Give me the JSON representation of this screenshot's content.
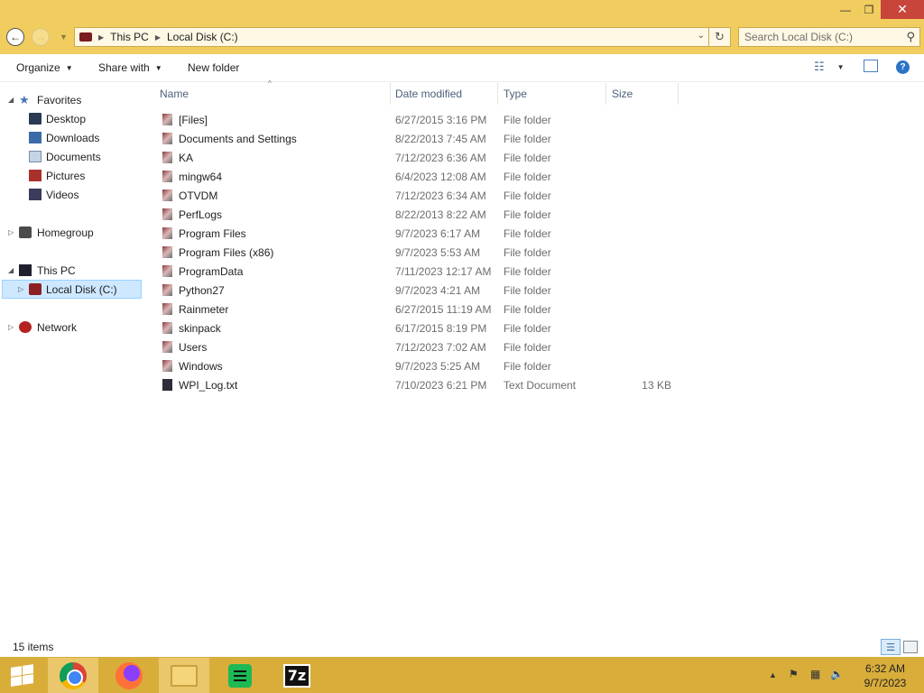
{
  "window": {
    "minimize_glyph": "—",
    "maximize_glyph": "❐",
    "close_glyph": "✕"
  },
  "address": {
    "back_glyph": "←",
    "forward_glyph": "→",
    "recent_glyph": "▼",
    "crumbs": [
      "This PC",
      "Local Disk (C:)"
    ],
    "separator_glyph": "▶",
    "dropdown_glyph": "⌄",
    "refresh_glyph": "↻",
    "search_placeholder": "Search Local Disk (C:)",
    "search_icon_glyph": "⚲"
  },
  "toolbar": {
    "organize": "Organize",
    "share_with": "Share with",
    "new_folder": "New folder",
    "caret_glyph": "▼",
    "views_glyph": "☷",
    "help_glyph": "?"
  },
  "nav": {
    "favorites": {
      "label": "Favorites",
      "items": [
        "Desktop",
        "Downloads",
        "Documents",
        "Pictures",
        "Videos"
      ]
    },
    "homegroup": "Homegroup",
    "this_pc": "This PC",
    "local_disk": "Local Disk (C:)",
    "network": "Network",
    "expanded_glyph": "◢",
    "collapsed_glyph": "▷",
    "star_glyph": "★"
  },
  "columns": {
    "name": "Name",
    "date": "Date modified",
    "type": "Type",
    "size": "Size",
    "sort_glyph": "^"
  },
  "files": [
    {
      "name": "[Files]",
      "date": "6/27/2015 3:16 PM",
      "type": "File folder",
      "size": ""
    },
    {
      "name": "Documents and Settings",
      "date": "8/22/2013 7:45 AM",
      "type": "File folder",
      "size": ""
    },
    {
      "name": "KA",
      "date": "7/12/2023 6:36 AM",
      "type": "File folder",
      "size": ""
    },
    {
      "name": "mingw64",
      "date": "6/4/2023 12:08 AM",
      "type": "File folder",
      "size": ""
    },
    {
      "name": "OTVDM",
      "date": "7/12/2023 6:34 AM",
      "type": "File folder",
      "size": ""
    },
    {
      "name": "PerfLogs",
      "date": "8/22/2013 8:22 AM",
      "type": "File folder",
      "size": ""
    },
    {
      "name": "Program Files",
      "date": "9/7/2023 6:17 AM",
      "type": "File folder",
      "size": ""
    },
    {
      "name": "Program Files (x86)",
      "date": "9/7/2023 5:53 AM",
      "type": "File folder",
      "size": ""
    },
    {
      "name": "ProgramData",
      "date": "7/11/2023 12:17 AM",
      "type": "File folder",
      "size": ""
    },
    {
      "name": "Python27",
      "date": "9/7/2023 4:21 AM",
      "type": "File folder",
      "size": ""
    },
    {
      "name": "Rainmeter",
      "date": "6/27/2015 11:19 AM",
      "type": "File folder",
      "size": ""
    },
    {
      "name": "skinpack",
      "date": "6/17/2015 8:19 PM",
      "type": "File folder",
      "size": ""
    },
    {
      "name": "Users",
      "date": "7/12/2023 7:02 AM",
      "type": "File folder",
      "size": ""
    },
    {
      "name": "Windows",
      "date": "9/7/2023 5:25 AM",
      "type": "File folder",
      "size": ""
    },
    {
      "name": "WPI_Log.txt",
      "date": "7/10/2023 6:21 PM",
      "type": "Text Document",
      "size": "13 KB"
    }
  ],
  "status": {
    "item_count": "15 items",
    "details_glyph": "☰"
  },
  "taskbar": {
    "apps": [
      "chrome-icon",
      "firefox-icon",
      "file-explorer-icon",
      "spreadsheet-icon",
      "7zip-icon"
    ],
    "zip_label": "7z",
    "tray_up_glyph": "▲",
    "tray_flag_glyph": "⚑",
    "tray_network_glyph": "▦",
    "tray_volume_glyph": "🔈",
    "time": "6:32 AM",
    "date": "9/7/2023"
  },
  "colors": {
    "accent": "#f1cd5f",
    "taskbar": "#d9ad3a",
    "close": "#c7453a",
    "selection": "#cde8ff"
  }
}
